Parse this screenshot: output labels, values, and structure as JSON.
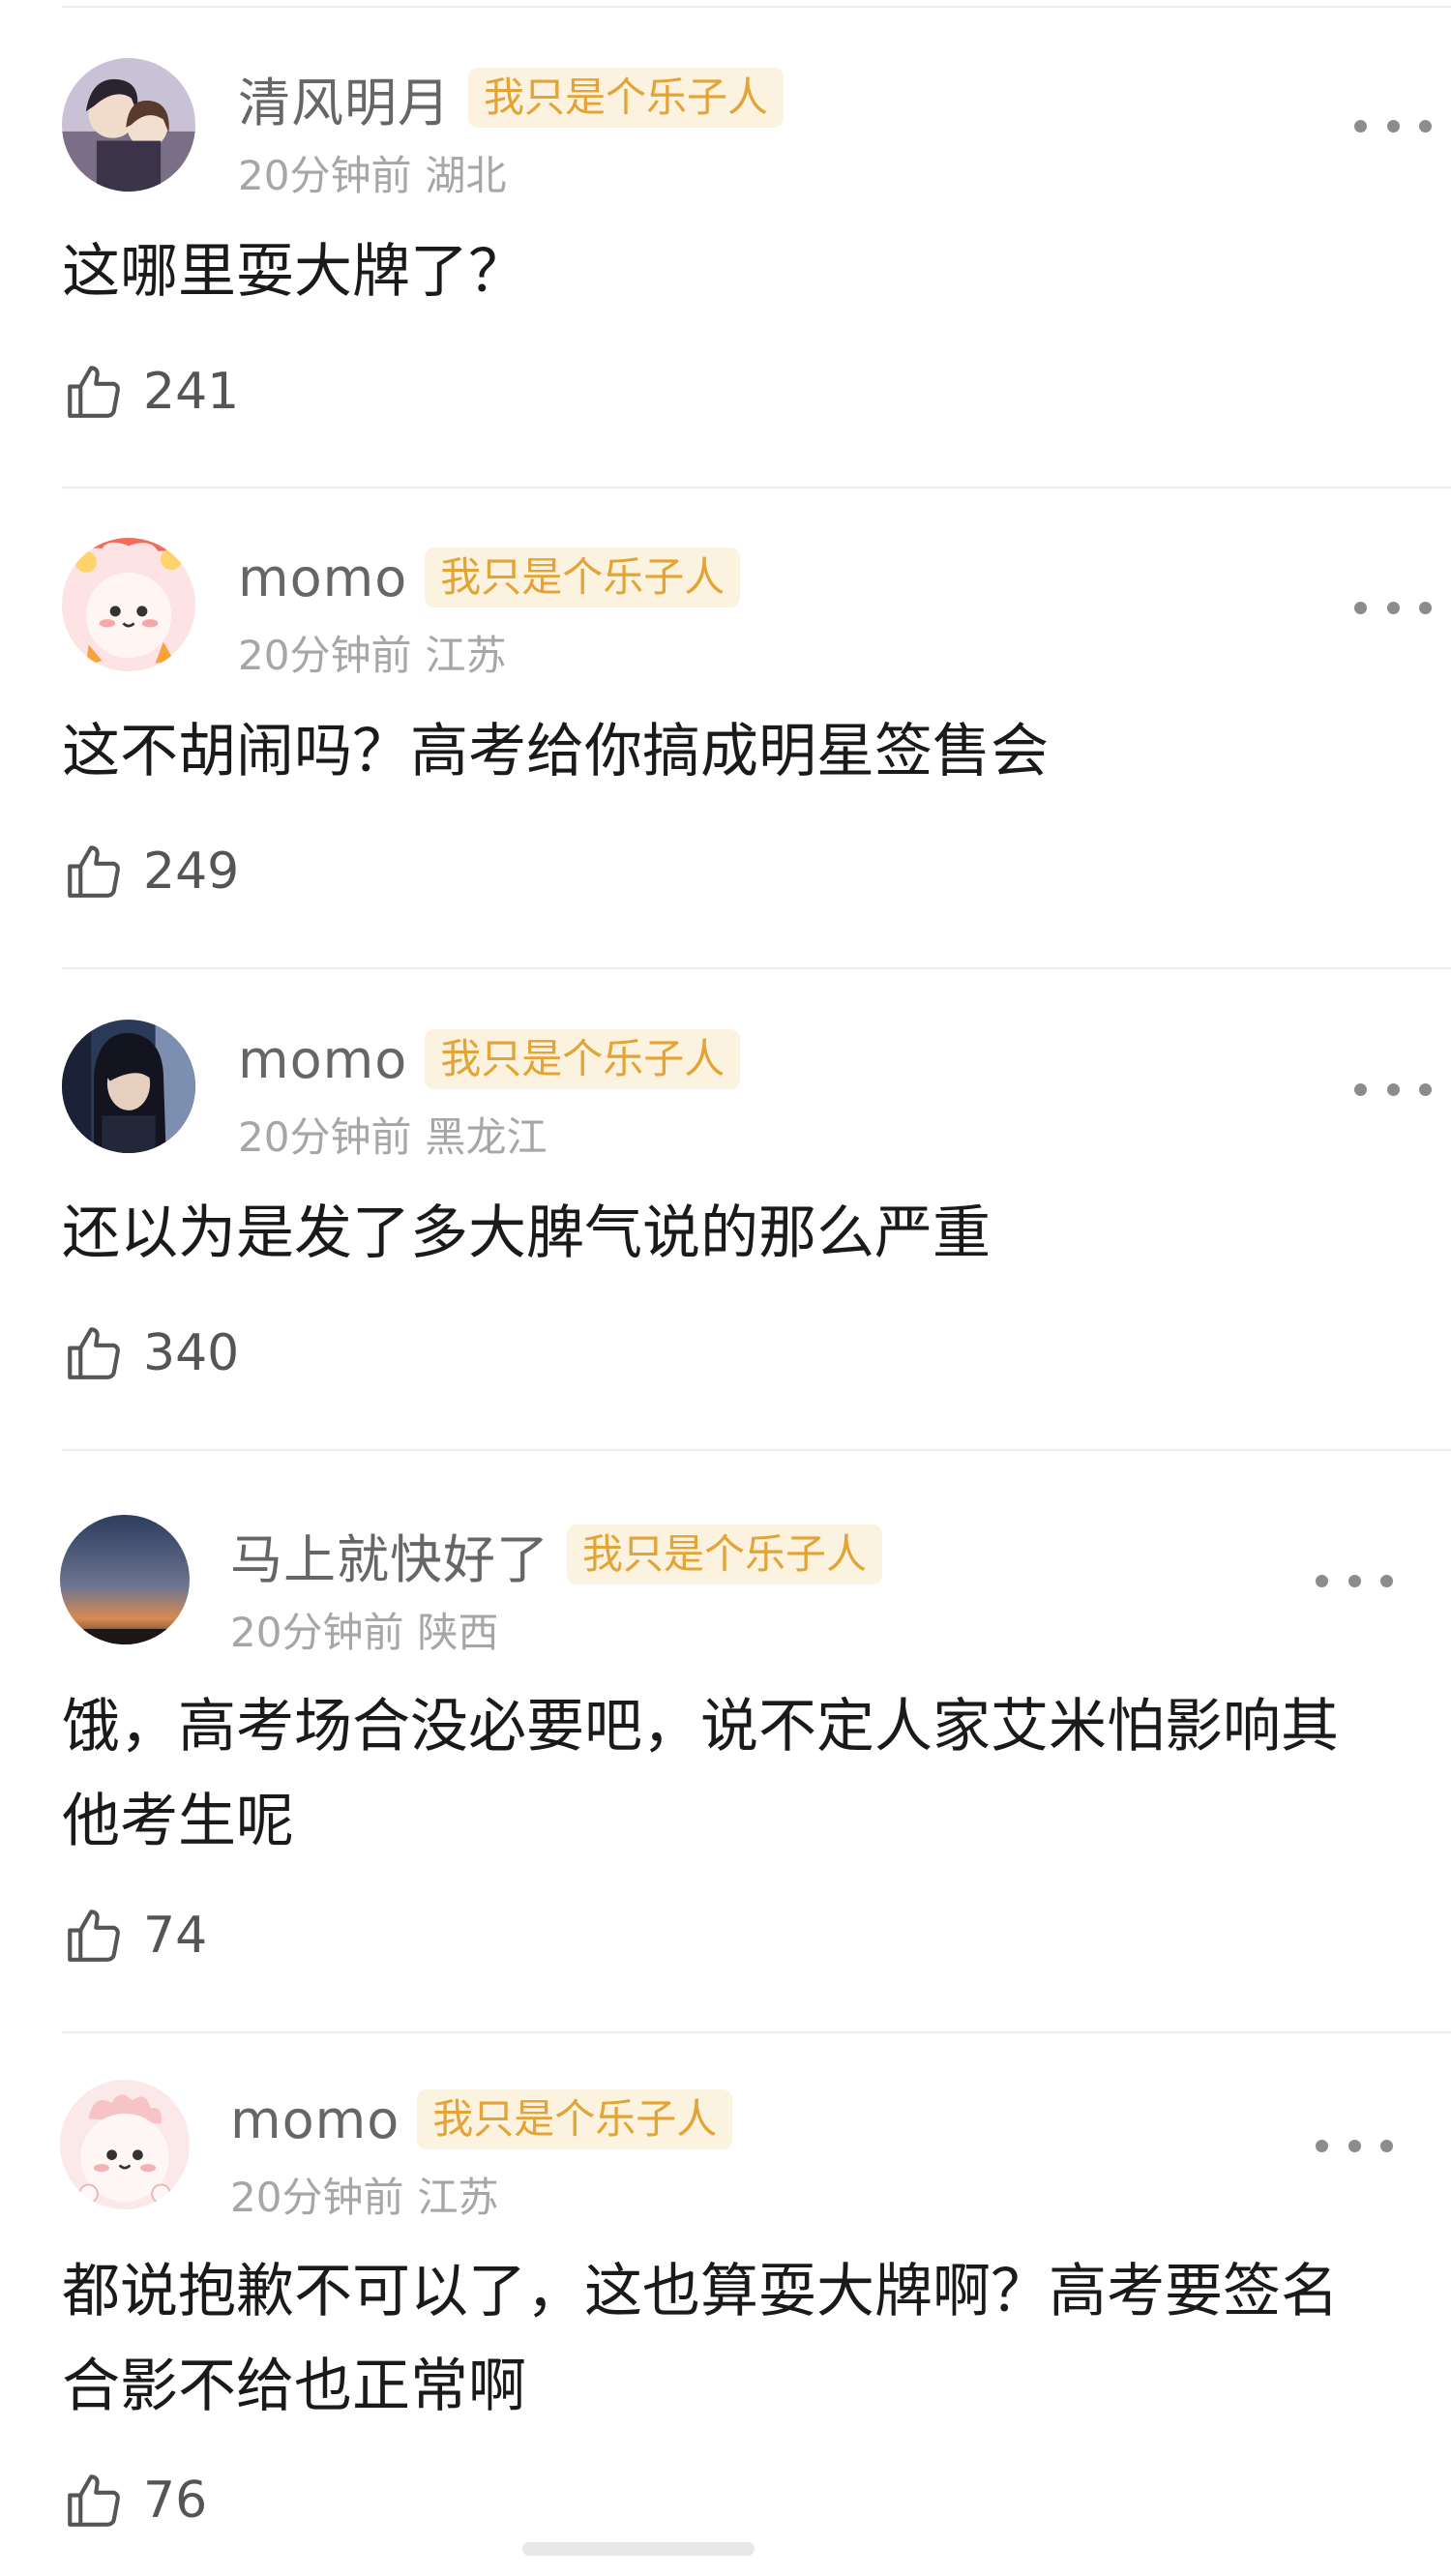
{
  "comments": [
    {
      "username": "清风明月",
      "badge": "我只是个乐子人",
      "time": "20分钟前",
      "location": "湖北",
      "text": "这哪里耍大牌了？",
      "likes": "241",
      "avatar": "anime-couple"
    },
    {
      "username": "momo",
      "badge": "我只是个乐子人",
      "time": "20分钟前",
      "location": "江苏",
      "text": "这不胡闹吗？高考给你搞成明星签售会",
      "likes": "249",
      "avatar": "pink-cartoon-flowers"
    },
    {
      "username": "momo",
      "badge": "我只是个乐子人",
      "time": "20分钟前",
      "location": "黑龙江",
      "text": "还以为是发了多大脾气说的那么严重",
      "likes": "340",
      "avatar": "girl-photo"
    },
    {
      "username": "马上就快好了",
      "badge": "我只是个乐子人",
      "time": "20分钟前",
      "location": "陕西",
      "text": "饿，高考场合没必要吧，说不定人家艾米怕影响其他考生呢",
      "likes": "74",
      "avatar": "sunset-sky"
    },
    {
      "username": "momo",
      "badge": "我只是个乐子人",
      "time": "20分钟前",
      "location": "江苏",
      "text": "都说抱歉不可以了，这也算耍大牌啊？高考要签名合影不给也正常啊",
      "likes": "76",
      "avatar": "pink-cartoon"
    }
  ],
  "icons": {
    "like": "thumbs-up-icon",
    "more": "more-dots-icon"
  },
  "colors": {
    "badge_bg": "#fbf3df",
    "badge_text": "#e3a335",
    "username": "#666666",
    "meta": "#a6a6a6"
  }
}
